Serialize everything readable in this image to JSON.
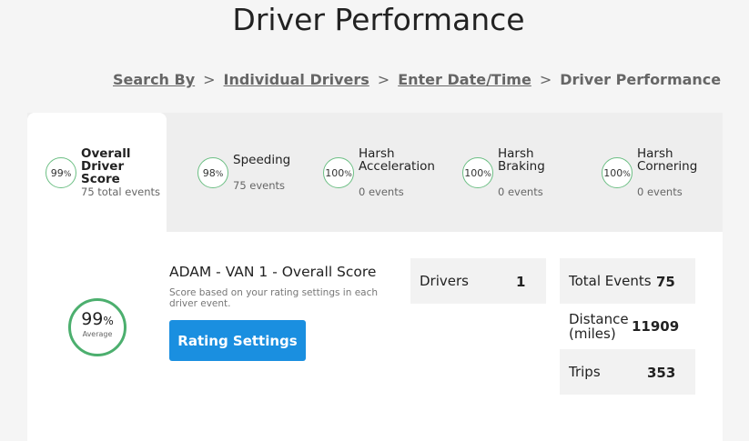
{
  "page_title": "Driver Performance",
  "breadcrumb": {
    "items": [
      "Search By",
      "Individual Drivers",
      "Enter Date/Time"
    ],
    "current": "Driver Performance",
    "separator": ">"
  },
  "tabs": [
    {
      "pct": "99",
      "pct_sign": "%",
      "title": "Overall\nDriver Score",
      "sub": "75 total events"
    },
    {
      "pct": "98",
      "pct_sign": "%",
      "title": "Speeding",
      "sub": "75 events"
    },
    {
      "pct": "100",
      "pct_sign": "%",
      "title": "Harsh\nAcceleration",
      "sub": "0 events"
    },
    {
      "pct": "100",
      "pct_sign": "%",
      "title": "Harsh\nBraking",
      "sub": "0 events"
    },
    {
      "pct": "100",
      "pct_sign": "%",
      "title": "Harsh\nCornering",
      "sub": "0 events"
    }
  ],
  "score": {
    "pct": "99",
    "pct_sign": "%",
    "label": "Average",
    "title": "ADAM - VAN 1 - Overall Score",
    "description": "Score based on your rating settings in each driver event.",
    "button_label": "Rating Settings"
  },
  "stats": {
    "drivers_label": "Drivers",
    "drivers_value": "1",
    "total_events_label": "Total Events",
    "total_events_value": "75",
    "distance_label": "Distance\n(miles)",
    "distance_value": "11909",
    "trips_label": "Trips",
    "trips_value": "353"
  },
  "colors": {
    "accent_button": "#1a8fe0",
    "ring_green": "#4caf6e"
  }
}
